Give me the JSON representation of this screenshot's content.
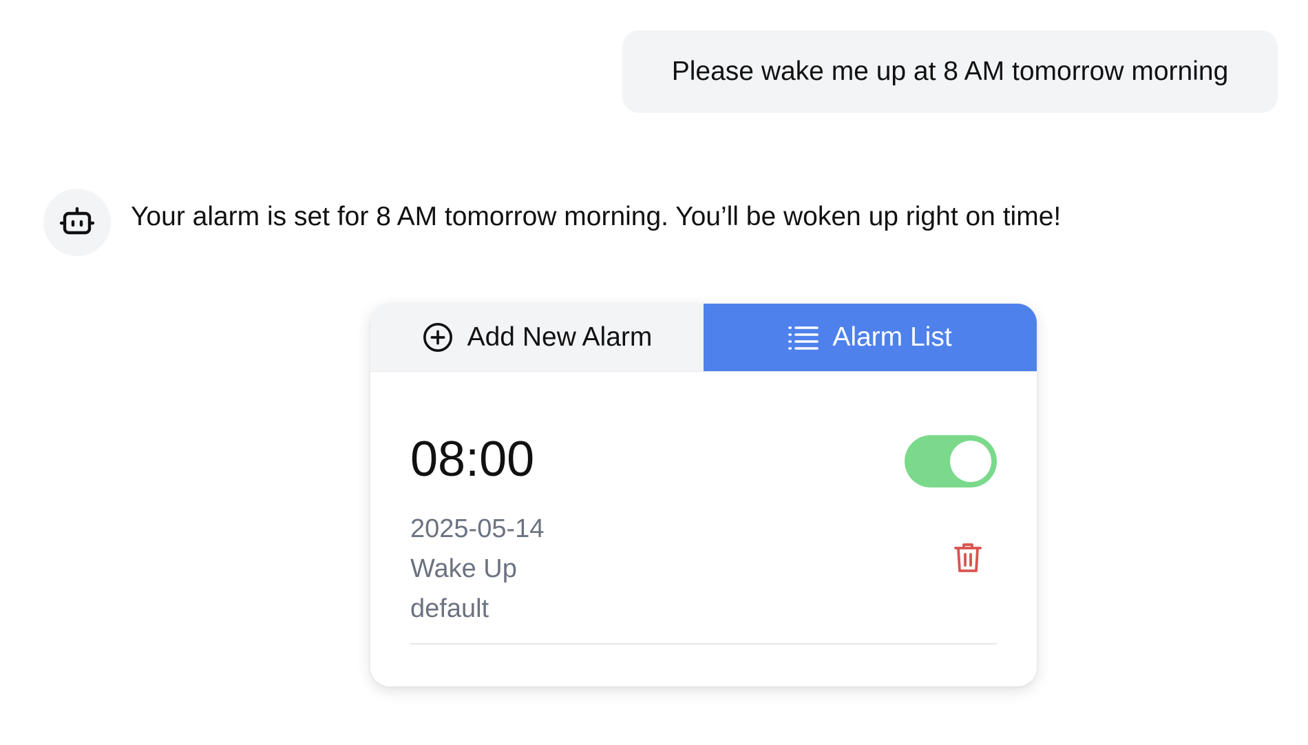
{
  "chat": {
    "user_message": "Please wake me up at 8 AM tomorrow morning",
    "assistant_message": "Your alarm is set for 8 AM tomorrow morning. You’ll be woken up right on time!"
  },
  "icons": {
    "avatar": "robot-icon",
    "add_tab": "plus-circle-icon",
    "list_tab": "list-icon",
    "delete": "trash-icon"
  },
  "alarm_widget": {
    "tabs": {
      "add_label": "Add New Alarm",
      "list_label": "Alarm List",
      "active": "list"
    },
    "alarms": [
      {
        "time": "08:00",
        "date": "2025-05-14",
        "label": "Wake Up",
        "sound": "default",
        "enabled": true
      }
    ]
  },
  "colors": {
    "active_tab": "#4f81ec",
    "toggle_on": "#7ad98a",
    "delete_icon": "#d9534f",
    "bubble_bg": "#f3f4f6",
    "meta_text": "#6b7280"
  }
}
